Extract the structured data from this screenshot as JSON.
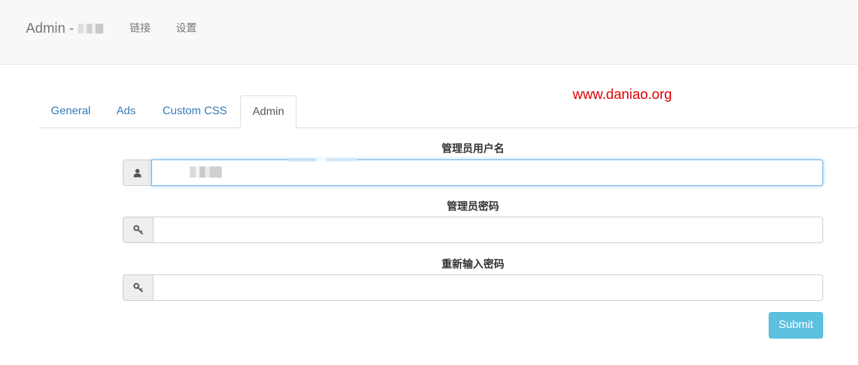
{
  "navbar": {
    "brand": "Admin -",
    "links": [
      "链接",
      "设置"
    ]
  },
  "watermark": "www.daniao.org",
  "tabs": [
    "General",
    "Ads",
    "Custom CSS",
    "Admin"
  ],
  "active_tab": "Admin",
  "form": {
    "username": {
      "label": "管理员用户名",
      "icon": "user-icon",
      "value": ""
    },
    "password": {
      "label": "管理员密码",
      "icon": "key-icon",
      "value": ""
    },
    "confirm_password": {
      "label": "重新输入密码",
      "icon": "key-icon",
      "value": ""
    },
    "submit_label": "Submit"
  },
  "colors": {
    "link": "#337ab7",
    "submit": "#5bc0de",
    "watermark": "#e00000",
    "focus": "#66afe9"
  }
}
